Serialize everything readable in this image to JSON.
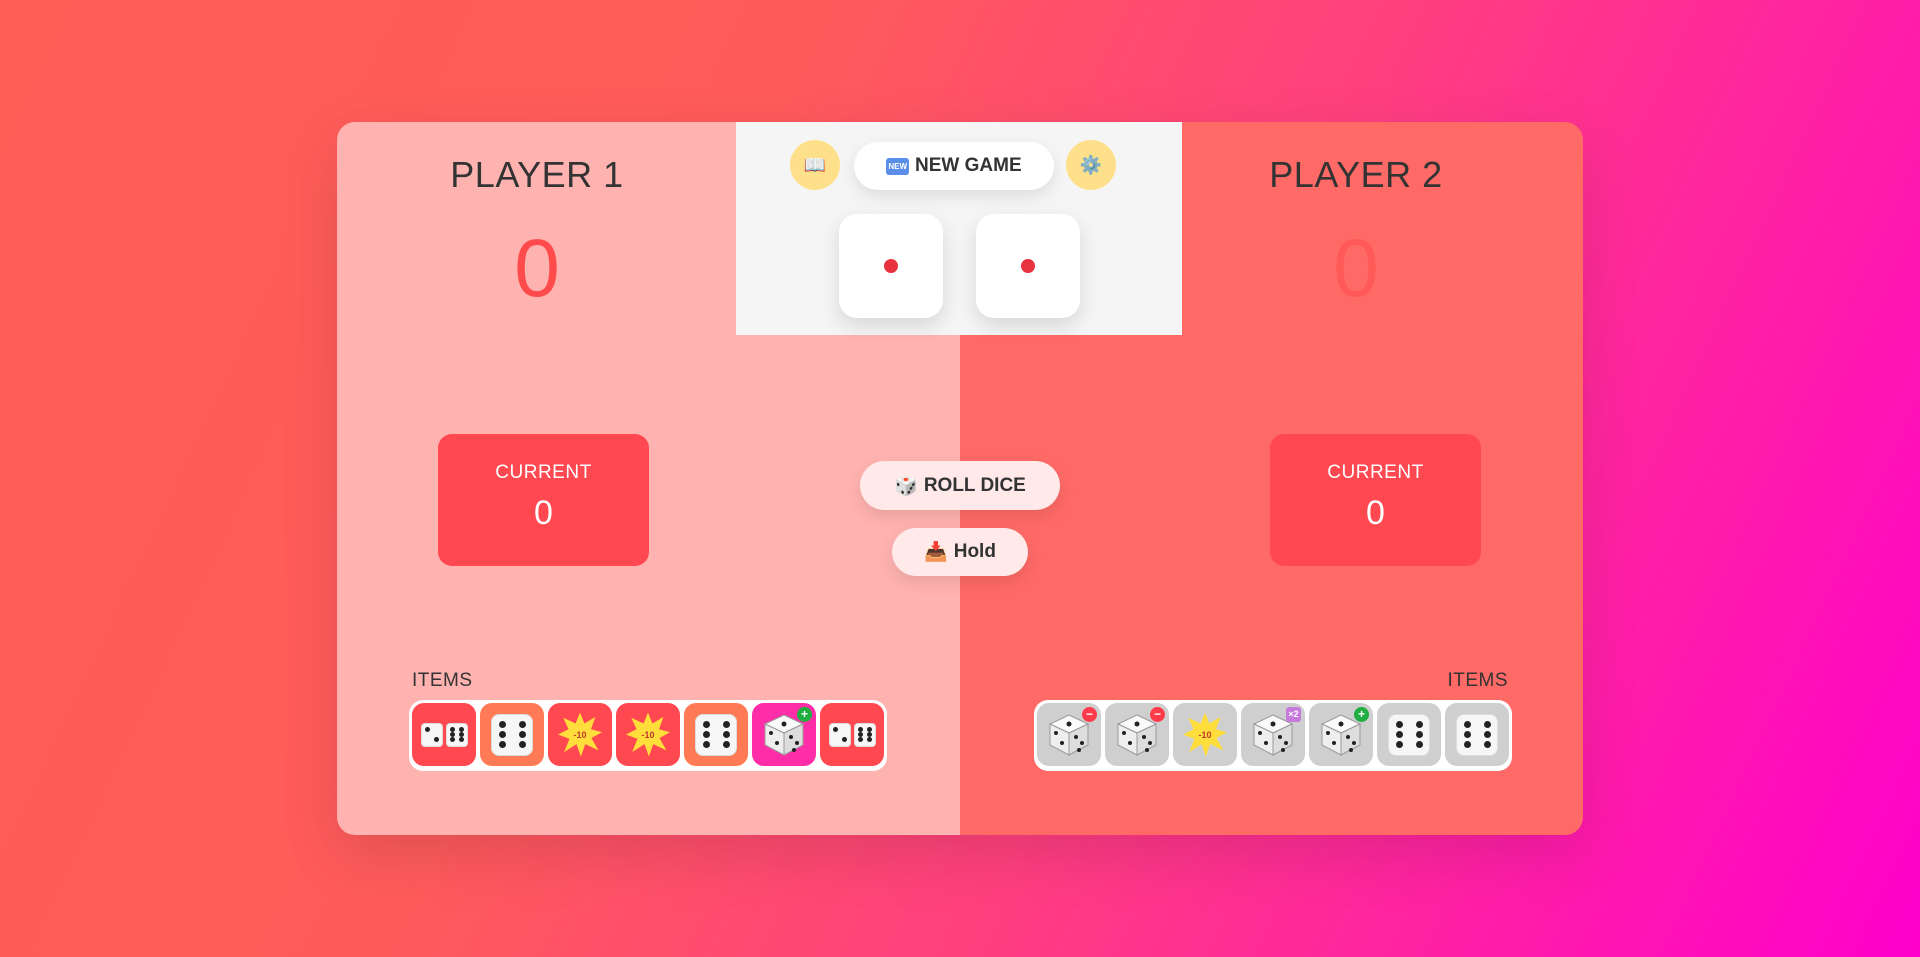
{
  "players": [
    {
      "name": "PLAYER 1",
      "score": "0",
      "current_label": "CURRENT",
      "current_value": "0",
      "items_label": "ITEMS"
    },
    {
      "name": "PLAYER 2",
      "score": "0",
      "current_label": "CURRENT",
      "current_value": "0",
      "items_label": "ITEMS"
    }
  ],
  "controls": {
    "rules_icon": "📖",
    "settings_icon": "⚙️",
    "new_game_label": "NEW GAME",
    "new_game_icon": "NEW",
    "roll_icon": "🎲",
    "roll_label": "ROLL DICE",
    "hold_icon": "📥",
    "hold_label": "Hold"
  },
  "dice": [
    1,
    1
  ],
  "colors": {
    "accent": "#ff484f",
    "player1_panel": "#ffb3b0",
    "player2_panel": "#ff6a66",
    "icon_button": "#ffe08a"
  },
  "items_player1": [
    "double-dice-item",
    "six-die-item",
    "explosion-item",
    "explosion-item",
    "six-die-item",
    "add-die-item",
    "double-dice-item"
  ],
  "items_player2": [
    "minus-die-item",
    "minus-die-item",
    "explosion-item",
    "x2-die-item",
    "add-die-item",
    "six-die-item",
    "six-die-item"
  ],
  "burst_text": "-10",
  "x2_text": "×2"
}
